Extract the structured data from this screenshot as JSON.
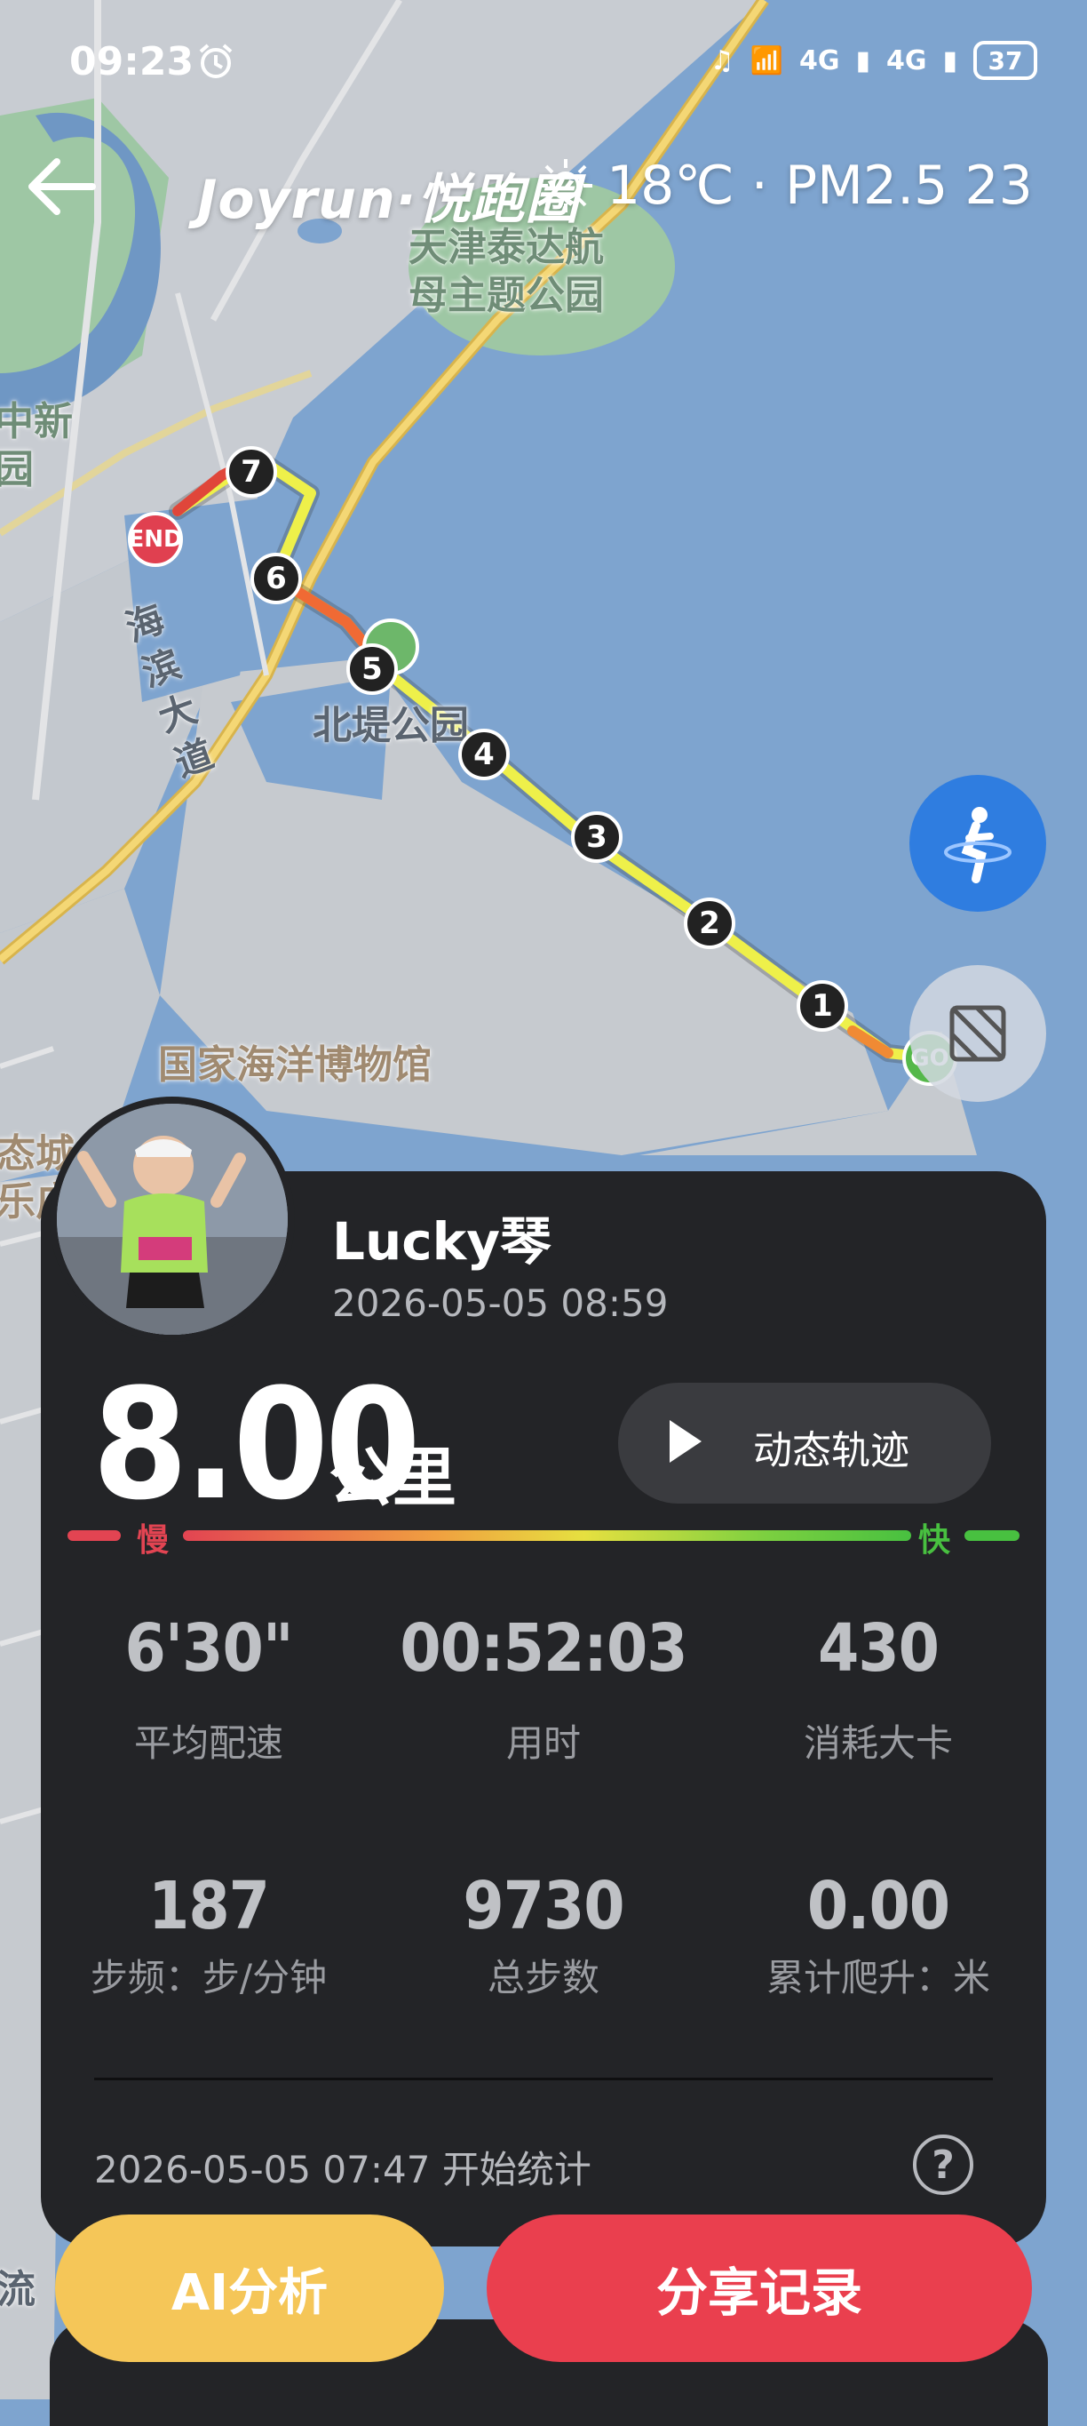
{
  "status_bar": {
    "time": "09:23",
    "network1": "4G",
    "network2": "4G",
    "battery": "37"
  },
  "header": {
    "brand": "Joyrun·悦跑圈",
    "weather": "18℃ · PM2.5 23"
  },
  "map": {
    "labels": {
      "park_top": "天津泰达航\n母主题公园",
      "left_top": "中新\n园",
      "road": "海\n滨\n大\n道",
      "beidi": "北堤公园",
      "museum": "国家海洋博物馆",
      "left_bottom": "态城\n乐广",
      "left_edge": "流"
    },
    "markers": [
      "1",
      "2",
      "3",
      "4",
      "5",
      "6",
      "7"
    ],
    "end_label": "END",
    "go_label": "GO"
  },
  "profile": {
    "name": "Lucky琴",
    "datetime": "2026-05-05 08:59"
  },
  "summary": {
    "distance": "8.00",
    "unit": "公里",
    "play_label": "动态轨迹",
    "slow": "慢",
    "fast": "快"
  },
  "stats": [
    {
      "value": "6'30\"",
      "label": "平均配速"
    },
    {
      "value": "00:52:03",
      "label": "用时"
    },
    {
      "value": "430",
      "label": "消耗大卡"
    },
    {
      "value": "187",
      "label": "步频：步/分钟"
    },
    {
      "value": "9730",
      "label": "总步数"
    },
    {
      "value": "0.00",
      "label": "累计爬升：米"
    }
  ],
  "start": {
    "text": "2026-05-05 07:47  开始统计"
  },
  "actions": {
    "ai": "AI分析",
    "share": "分享记录"
  },
  "colors": {
    "card": "#232427",
    "ai": "#f5c658",
    "share": "#ea3f4e",
    "slow": "#e24452",
    "fast": "#48c040",
    "water": "#7ea4cf"
  }
}
